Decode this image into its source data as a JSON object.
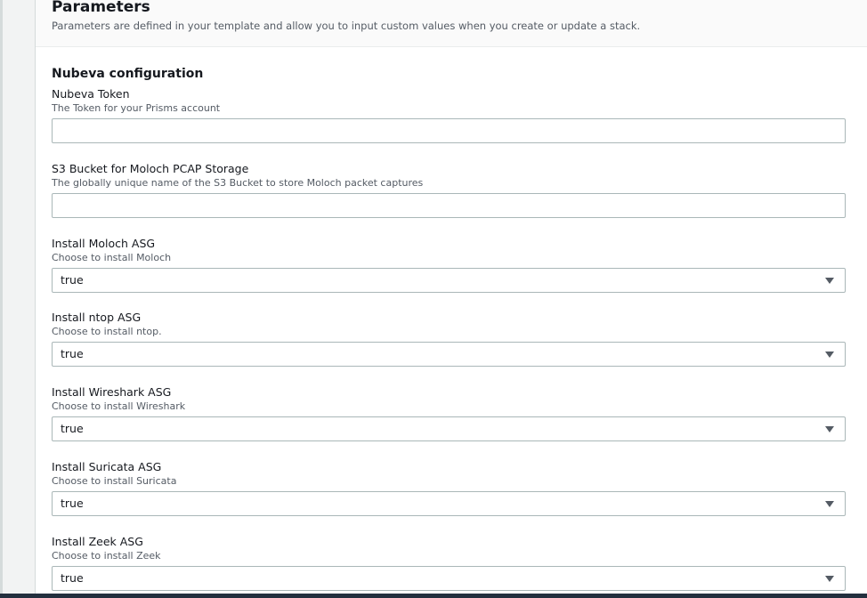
{
  "parameters": {
    "title": "Parameters",
    "description": "Parameters are defined in your template and allow you to input custom values when you create or update a stack."
  },
  "section": {
    "title": "Nubeva configuration"
  },
  "fields": {
    "token": {
      "label": "Nubeva Token",
      "description": "The Token for your Prisms account",
      "value": ""
    },
    "bucket": {
      "label": "S3 Bucket for Moloch PCAP Storage",
      "description": "The globally unique name of the S3 Bucket to store Moloch packet captures",
      "value": ""
    },
    "moloch": {
      "label": "Install Moloch ASG",
      "description": "Choose to install Moloch",
      "value": "true"
    },
    "ntop": {
      "label": "Install ntop ASG",
      "description": "Choose to install ntop.",
      "value": "true"
    },
    "wireshark": {
      "label": "Install Wireshark ASG",
      "description": "Choose to install Wireshark",
      "value": "true"
    },
    "suricata": {
      "label": "Install Suricata ASG",
      "description": "Choose to install Suricata",
      "value": "true"
    },
    "zeek": {
      "label": "Install Zeek ASG",
      "description": "Choose to install Zeek",
      "value": "true"
    }
  },
  "icons": {
    "select_caret": "caret-down-icon"
  }
}
